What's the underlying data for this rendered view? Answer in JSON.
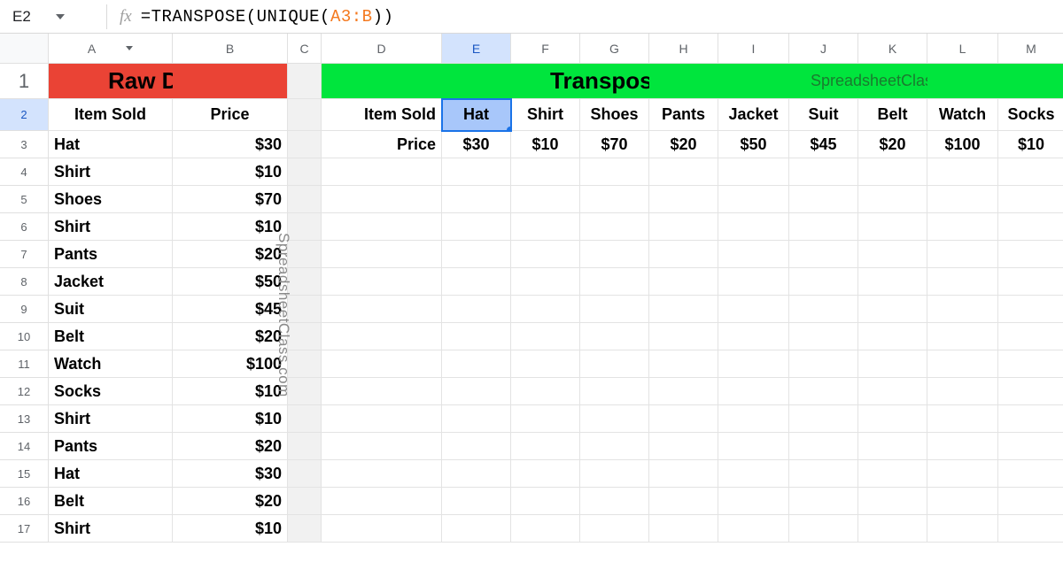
{
  "name_box": "E2",
  "formula": {
    "prefix": "=TRANSPOSE(UNIQUE(",
    "range": "A3:B",
    "suffix": "))"
  },
  "columns": [
    "A",
    "B",
    "C",
    "D",
    "E",
    "F",
    "G",
    "H",
    "I",
    "J",
    "K",
    "L",
    "M"
  ],
  "active_col": "E",
  "active_row": "2",
  "rows": [
    "1",
    "2",
    "3",
    "4",
    "5",
    "6",
    "7",
    "8",
    "9",
    "10",
    "11",
    "12",
    "13",
    "14",
    "15",
    "16",
    "17"
  ],
  "banner": {
    "raw": "Raw Data",
    "transposed": "Transposed",
    "watermark": "SpreadsheetClass.com"
  },
  "headers": {
    "item": "Item Sold",
    "price": "Price"
  },
  "raw_data": [
    {
      "item": "Hat",
      "price": "$30"
    },
    {
      "item": "Shirt",
      "price": "$10"
    },
    {
      "item": "Shoes",
      "price": "$70"
    },
    {
      "item": "Shirt",
      "price": "$10"
    },
    {
      "item": "Pants",
      "price": "$20"
    },
    {
      "item": "Jacket",
      "price": "$50"
    },
    {
      "item": "Suit",
      "price": "$45"
    },
    {
      "item": "Belt",
      "price": "$20"
    },
    {
      "item": "Watch",
      "price": "$100"
    },
    {
      "item": "Socks",
      "price": "$10"
    },
    {
      "item": "Shirt",
      "price": "$10"
    },
    {
      "item": "Pants",
      "price": "$20"
    },
    {
      "item": "Hat",
      "price": "$30"
    },
    {
      "item": "Belt",
      "price": "$20"
    },
    {
      "item": "Shirt",
      "price": "$10"
    }
  ],
  "transposed": {
    "row_labels": [
      "Item Sold",
      "Price"
    ],
    "items": [
      "Hat",
      "Shirt",
      "Shoes",
      "Pants",
      "Jacket",
      "Suit",
      "Belt",
      "Watch",
      "Socks"
    ],
    "prices": [
      "$30",
      "$10",
      "$70",
      "$20",
      "$50",
      "$45",
      "$20",
      "$100",
      "$10"
    ]
  },
  "vertical_watermark": "SpreadsheetClass.com"
}
